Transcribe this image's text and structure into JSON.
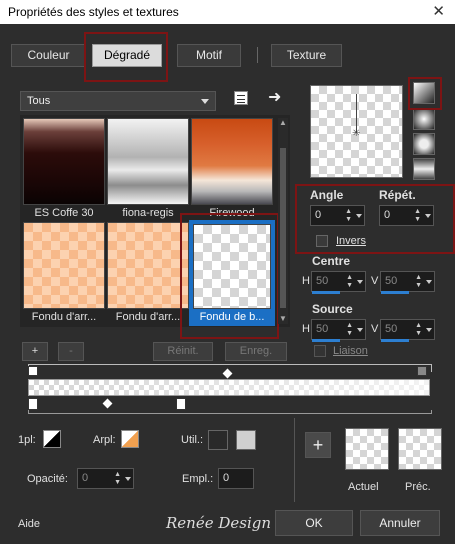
{
  "window": {
    "title": "Propriétés des styles et textures",
    "close": "✕"
  },
  "tabs": [
    {
      "label": "Couleur"
    },
    {
      "label": "Dégradé"
    },
    {
      "label": "Motif"
    },
    {
      "label": "Texture"
    }
  ],
  "filter": {
    "selected": "Tous"
  },
  "gradients": [
    {
      "label": "ES Coffe 30"
    },
    {
      "label": "fiona-regis"
    },
    {
      "label": "Firewood"
    },
    {
      "label": "Fondu d'arr..."
    },
    {
      "label": "Fondu d'arr..."
    },
    {
      "label": "Fondu de b..."
    }
  ],
  "list_buttons": {
    "add": "+",
    "remove": "-",
    "reset": "Réinit.",
    "save": "Enreg."
  },
  "angle": {
    "label": "Angle",
    "value": "0"
  },
  "repeat": {
    "label": "Répét.",
    "value": "0"
  },
  "invert": {
    "label": "Invers"
  },
  "center": {
    "label": "Centre",
    "h_label": "H",
    "h_value": "50",
    "v_label": "V",
    "v_value": "50"
  },
  "source": {
    "label": "Source",
    "h_label": "H",
    "h_value": "50",
    "v_label": "V",
    "v_value": "50"
  },
  "link": {
    "label": "Liaison"
  },
  "stop": {
    "first_label": "1pl:",
    "back_label": "Arpl:",
    "use_label": "Util.:",
    "opacity_label": "Opacité:",
    "opacity_value": "0",
    "location_label": "Empl.:",
    "location_value": "0"
  },
  "preview": {
    "add": "+",
    "current": "Actuel",
    "previous": "Préc."
  },
  "footer": {
    "help": "Aide",
    "logo": "Renée Design",
    "ok": "OK",
    "cancel": "Annuler"
  },
  "colors": {
    "accent": "#2d7fd1",
    "highlight": "#7d1414"
  }
}
